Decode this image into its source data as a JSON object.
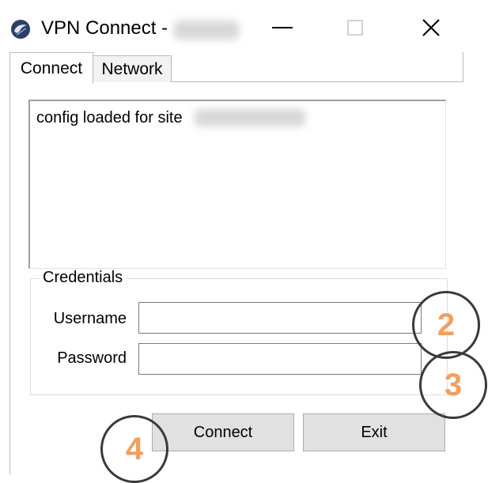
{
  "window": {
    "title": "VPN Connect -",
    "icon": "vpn-globe-icon"
  },
  "titlebar_buttons": {
    "minimize_glyph": "—",
    "maximize_glyph": "☐",
    "close_glyph": "✕"
  },
  "tabs": [
    {
      "label": "Connect",
      "active": true
    },
    {
      "label": "Network",
      "active": false
    }
  ],
  "log": {
    "line": "config loaded for site"
  },
  "credentials": {
    "legend": "Credentials",
    "username_label": "Username",
    "password_label": "Password",
    "username_value": "",
    "password_value": ""
  },
  "buttons": {
    "connect_label": "Connect",
    "exit_label": "Exit"
  },
  "callouts": [
    "2",
    "3",
    "4"
  ],
  "colors": {
    "callout_number": "#f0a060",
    "callout_ring": "#3a3a3a",
    "icon_fill": "#2b3f66"
  }
}
